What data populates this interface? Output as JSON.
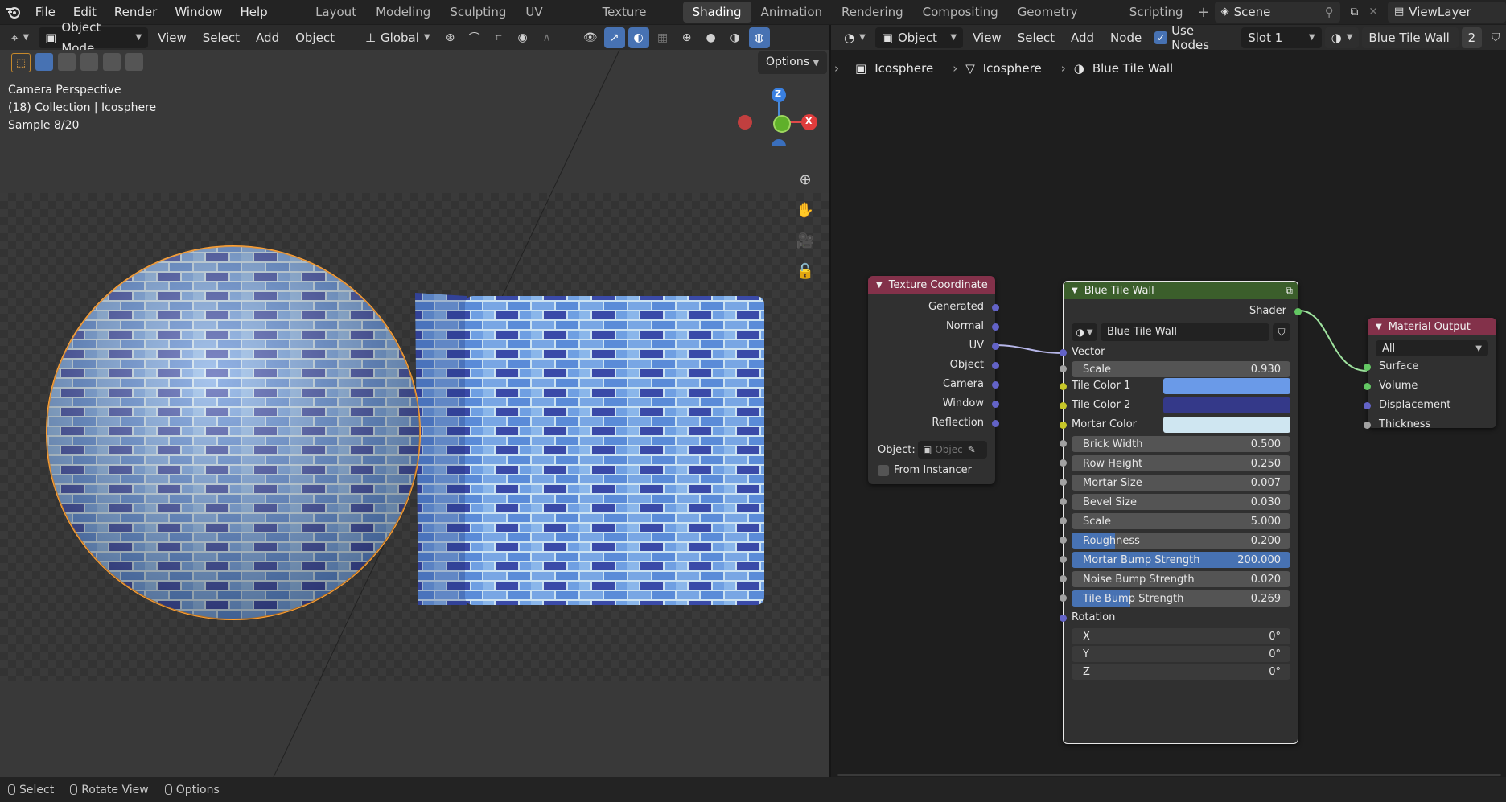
{
  "menus": [
    "File",
    "Edit",
    "Render",
    "Window",
    "Help"
  ],
  "workspaces": [
    "Layout",
    "Modeling",
    "Sculpting",
    "UV Editing",
    "Texture Paint",
    "Shading",
    "Animation",
    "Rendering",
    "Compositing",
    "Geometry Nodes",
    "Scripting"
  ],
  "active_workspace": "Shading",
  "scene": "Scene",
  "view_layer": "ViewLayer",
  "viewport": {
    "mode": "Object Mode",
    "menus": [
      "View",
      "Select",
      "Add",
      "Object"
    ],
    "orientation": "Global",
    "options_label": "Options",
    "info_line1": "Camera Perspective",
    "info_line2": "(18) Collection | Icosphere",
    "info_line3": "Sample 8/20",
    "gizmo": {
      "z": "Z",
      "x": "X"
    }
  },
  "node_editor": {
    "type": "Object",
    "menus": [
      "View",
      "Select",
      "Add",
      "Node"
    ],
    "use_nodes_label": "Use Nodes",
    "use_nodes": true,
    "slot": "Slot 1",
    "material": "Blue Tile Wall",
    "user_count": "2",
    "breadcrumb": [
      "Icosphere",
      "Icosphere",
      "Blue Tile Wall"
    ]
  },
  "texture_coordinate": {
    "title": "Texture Coordinate",
    "outputs": [
      "Generated",
      "Normal",
      "UV",
      "Object",
      "Camera",
      "Window",
      "Reflection"
    ],
    "object_label": "Object:",
    "object_placeholder": "Objec",
    "from_instancer": "From Instancer"
  },
  "group_node": {
    "title": "Blue Tile Wall",
    "output": "Shader",
    "datablock": "Blue Tile Wall",
    "vector_label": "Vector",
    "rotation_label": "Rotation",
    "fields": [
      {
        "label": "Scale",
        "value": "0.930",
        "fill": 0
      },
      {
        "label": "Brick Width",
        "value": "0.500",
        "fill": 0
      },
      {
        "label": "Row Height",
        "value": "0.250",
        "fill": 0
      },
      {
        "label": "Mortar Size",
        "value": "0.007",
        "fill": 0
      },
      {
        "label": "Bevel Size",
        "value": "0.030",
        "fill": 0
      },
      {
        "label": "Scale",
        "value": "5.000",
        "fill": 0
      },
      {
        "label": "Roughness",
        "value": "0.200",
        "fill": 0.2
      },
      {
        "label": "Mortar Bump Strength",
        "value": "200.000",
        "fill": 1
      },
      {
        "label": "Noise Bump Strength",
        "value": "0.020",
        "fill": 0
      },
      {
        "label": "Tile Bump Strength",
        "value": "0.269",
        "fill": 0.27
      }
    ],
    "colors": [
      {
        "label": "Tile Color 1",
        "color": "#6a9ae8"
      },
      {
        "label": "Tile Color 2",
        "color": "#343989"
      },
      {
        "label": "Mortar Color",
        "color": "#cfe6f1"
      }
    ],
    "rotation": [
      {
        "label": "X",
        "value": "0°"
      },
      {
        "label": "Y",
        "value": "0°"
      },
      {
        "label": "Z",
        "value": "0°"
      }
    ]
  },
  "material_output": {
    "title": "Material Output",
    "target": "All",
    "inputs": [
      "Surface",
      "Volume",
      "Displacement",
      "Thickness"
    ]
  },
  "statusbar": [
    "Select",
    "Rotate View",
    "Options"
  ],
  "colors": {
    "accent": "#4772b3",
    "texcoord_header": "#83314a",
    "group_header": "#3b5e2b",
    "output_header": "#83314a",
    "selection": "#ffa033"
  }
}
